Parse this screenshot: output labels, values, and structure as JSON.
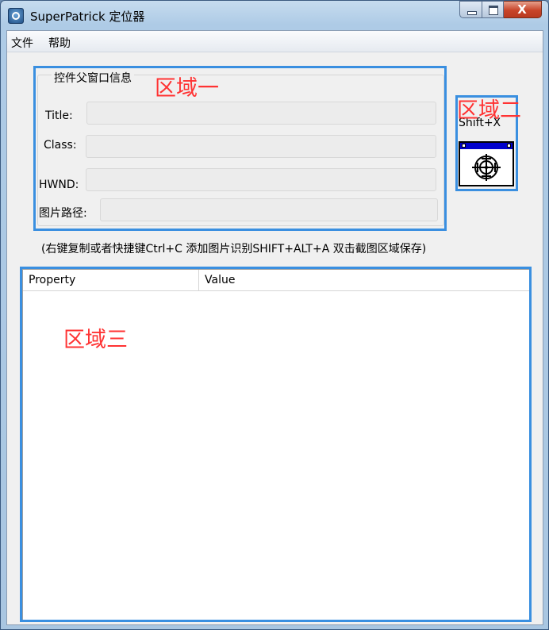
{
  "window": {
    "title": "SuperPatrick 定位器",
    "close_symbol": "X"
  },
  "menu": [
    "文件",
    "帮助"
  ],
  "group": {
    "title": "控件父窗口信息",
    "fields": [
      {
        "label": "Title:",
        "value": ""
      },
      {
        "label": "Class:",
        "value": ""
      },
      {
        "label": "HWND:",
        "value": ""
      },
      {
        "label": "图片路径:",
        "value": ""
      }
    ]
  },
  "finder": {
    "hotkey": "Shift+X",
    "icon": "crosshair-finder-icon"
  },
  "hint": "(右键复制或者快捷键Ctrl+C  添加图片识别SHIFT+ALT+A 双击截图区域保存)",
  "table": {
    "columns": [
      "Property",
      "Value"
    ],
    "rows": []
  },
  "annotations": {
    "region1": "区域一",
    "region2": "区域二",
    "region3": "区域三"
  },
  "colors": {
    "annotation_box": "#3a8fe0",
    "annotation_text": "#ff3333",
    "finder_bar": "#0000cc"
  }
}
